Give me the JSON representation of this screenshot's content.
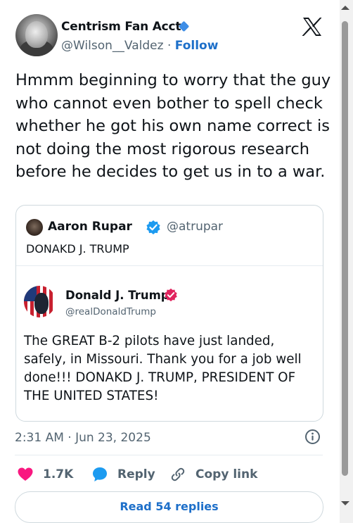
{
  "tweet": {
    "author_name": "Centrism Fan Acct",
    "handle": "@Wilson__Valdez",
    "separator": "·",
    "follow_label": "Follow",
    "text": "Hmmm beginning to worry that the guy who cannot even bother to spell check whether he got his own name correct is not doing the most rigorous research before he decides to get us in to a war.",
    "timestamp": "2:31 AM · Jun 23, 2025"
  },
  "quote": {
    "author_name": "Aaron Rupar",
    "handle": "@atrupar",
    "text": "DONAKD J. TRUMP",
    "embedded": {
      "author_name": "Donald J. Trump",
      "handle": "@realDonaldTrump",
      "text": "The GREAT B-2 pilots have just landed, safely, in Missouri. Thank you for a job well done!!! DONAKD J. TRUMP, PRESIDENT OF THE UNITED STATES!"
    }
  },
  "actions": {
    "like_count": "1.7K",
    "reply_label": "Reply",
    "copy_link_label": "Copy link",
    "read_replies_label": "Read 54 replies"
  },
  "icons": {
    "logo": "x-logo-icon",
    "verified_owner": "diamond-badge-icon",
    "verified_quote": "blue-check-icon",
    "verified_embedded": "pink-check-icon",
    "info": "info-icon",
    "like": "heart-icon",
    "reply": "speech-bubble-icon",
    "copy": "link-icon"
  },
  "colors": {
    "accent_blue": "#1d6fc9",
    "heart": "#f91880",
    "verified_blue": "#1d9bf0",
    "verified_pink": "#e0245e",
    "muted_text": "#536471"
  }
}
